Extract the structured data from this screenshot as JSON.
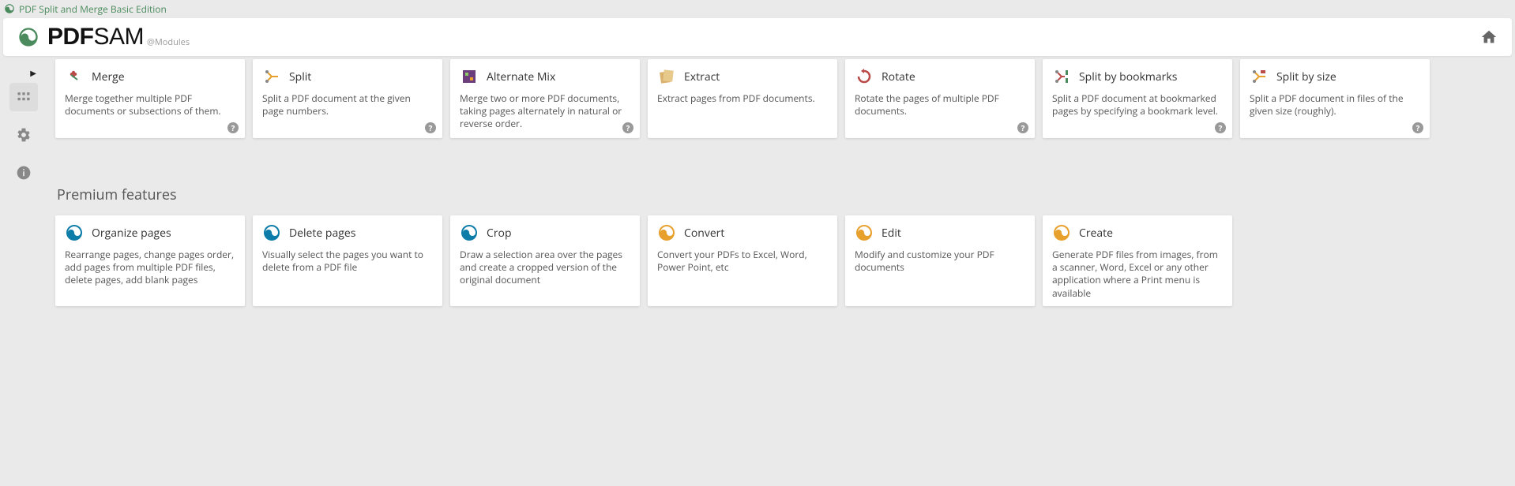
{
  "window": {
    "title": "PDF Split and Merge Basic Edition"
  },
  "header": {
    "brand_pdf": "PDF",
    "brand_sam": "SAM",
    "subtitle": "@Modules"
  },
  "modules": [
    {
      "id": "merge",
      "title": "Merge",
      "desc": "Merge together multiple PDF documents or subsections of them.",
      "help": true
    },
    {
      "id": "split",
      "title": "Split",
      "desc": "Split a PDF document at the given page numbers.",
      "help": true
    },
    {
      "id": "altmix",
      "title": "Alternate Mix",
      "desc": "Merge two or more PDF documents, taking pages alternately in natural or reverse order.",
      "help": true
    },
    {
      "id": "extract",
      "title": "Extract",
      "desc": "Extract pages from PDF documents.",
      "help": false
    },
    {
      "id": "rotate",
      "title": "Rotate",
      "desc": "Rotate the pages of multiple PDF documents.",
      "help": true
    },
    {
      "id": "splitbm",
      "title": "Split by bookmarks",
      "desc": "Split a PDF document at bookmarked pages by specifying a bookmark level.",
      "help": true
    },
    {
      "id": "splitsize",
      "title": "Split by size",
      "desc": "Split a PDF document in files of the given size (roughly).",
      "help": true
    }
  ],
  "premium_heading": "Premium features",
  "premium": [
    {
      "id": "organize",
      "title": "Organize pages",
      "desc": "Rearrange pages, change pages order, add pages from multiple PDF files, delete pages, add blank pages",
      "color": "blue"
    },
    {
      "id": "delete",
      "title": "Delete pages",
      "desc": "Visually select the pages you want to delete from a PDF file",
      "color": "blue"
    },
    {
      "id": "crop",
      "title": "Crop",
      "desc": "Draw a selection area over the pages and create a cropped version of the original document",
      "color": "blue"
    },
    {
      "id": "convert",
      "title": "Convert",
      "desc": "Convert your PDFs to Excel, Word, Power Point, etc",
      "color": "orange"
    },
    {
      "id": "edit",
      "title": "Edit",
      "desc": "Modify and customize your PDF documents",
      "color": "orange"
    },
    {
      "id": "create",
      "title": "Create",
      "desc": "Generate PDF files from images, from a scanner, Word, Excel or any other application where a Print menu is available",
      "color": "orange"
    }
  ]
}
